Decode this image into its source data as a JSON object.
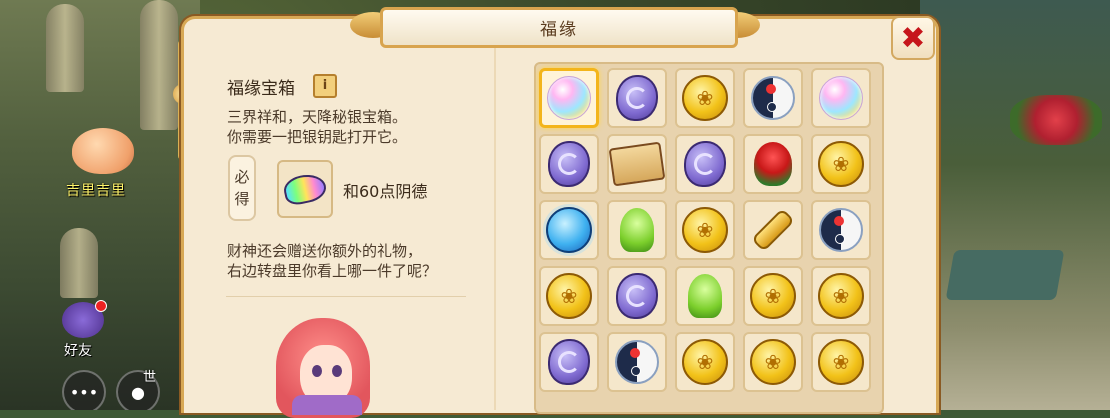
{
  "background": {
    "pet_name": "吉里吉里",
    "friend_label": "好友",
    "world_label": "世"
  },
  "panel": {
    "title": "福缘",
    "close_symbol": "✖",
    "chest_name": "福缘宝箱",
    "info_symbol": "i",
    "description_line1": "三界祥和，天降秘银宝箱。",
    "description_line2": "你需要一把银钥匙打开它。",
    "must_label_1": "必",
    "must_label_2": "得",
    "requirement_text": "和60点阴德",
    "bonus_line1": "财神还会赠送你额外的礼物，",
    "bonus_line2": "右边转盘里你看上哪一件了呢？"
  },
  "reward_grid": {
    "selected_index": 0,
    "rows": [
      [
        "rainbow-orb",
        "purple-stone",
        "gold-coin",
        "yinyang-pearl",
        "rainbow-orb"
      ],
      [
        "purple-stone",
        "treasure-scroll",
        "purple-stone",
        "red-rose",
        "gold-coin"
      ],
      [
        "planet-orb",
        "green-sprout",
        "gold-coin",
        "golden-key",
        "yinyang-pearl"
      ],
      [
        "gold-coin",
        "purple-stone",
        "green-sprout",
        "gold-coin",
        "gold-coin"
      ],
      [
        "purple-stone",
        "yinyang-pearl",
        "gold-coin",
        "gold-coin",
        "gold-coin"
      ]
    ]
  }
}
